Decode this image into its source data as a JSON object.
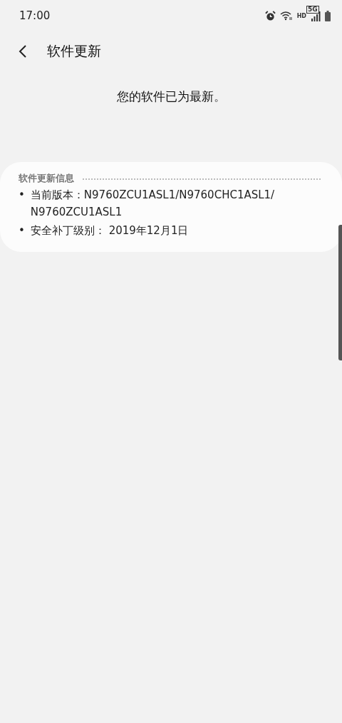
{
  "status_bar": {
    "time": "17:00",
    "hd_label": "HD",
    "network_label": "5G"
  },
  "header": {
    "title": "软件更新"
  },
  "message": "您的软件已为最新。",
  "info_card": {
    "title": "软件更新信息",
    "items": [
      {
        "bullet": "•",
        "text": "当前版本：N9760ZCU1ASL1/N9760CHC1ASL1/ N9760ZCU1ASL1"
      },
      {
        "bullet": "•",
        "text": "安全补丁级别： 2019年12月1日"
      }
    ]
  }
}
